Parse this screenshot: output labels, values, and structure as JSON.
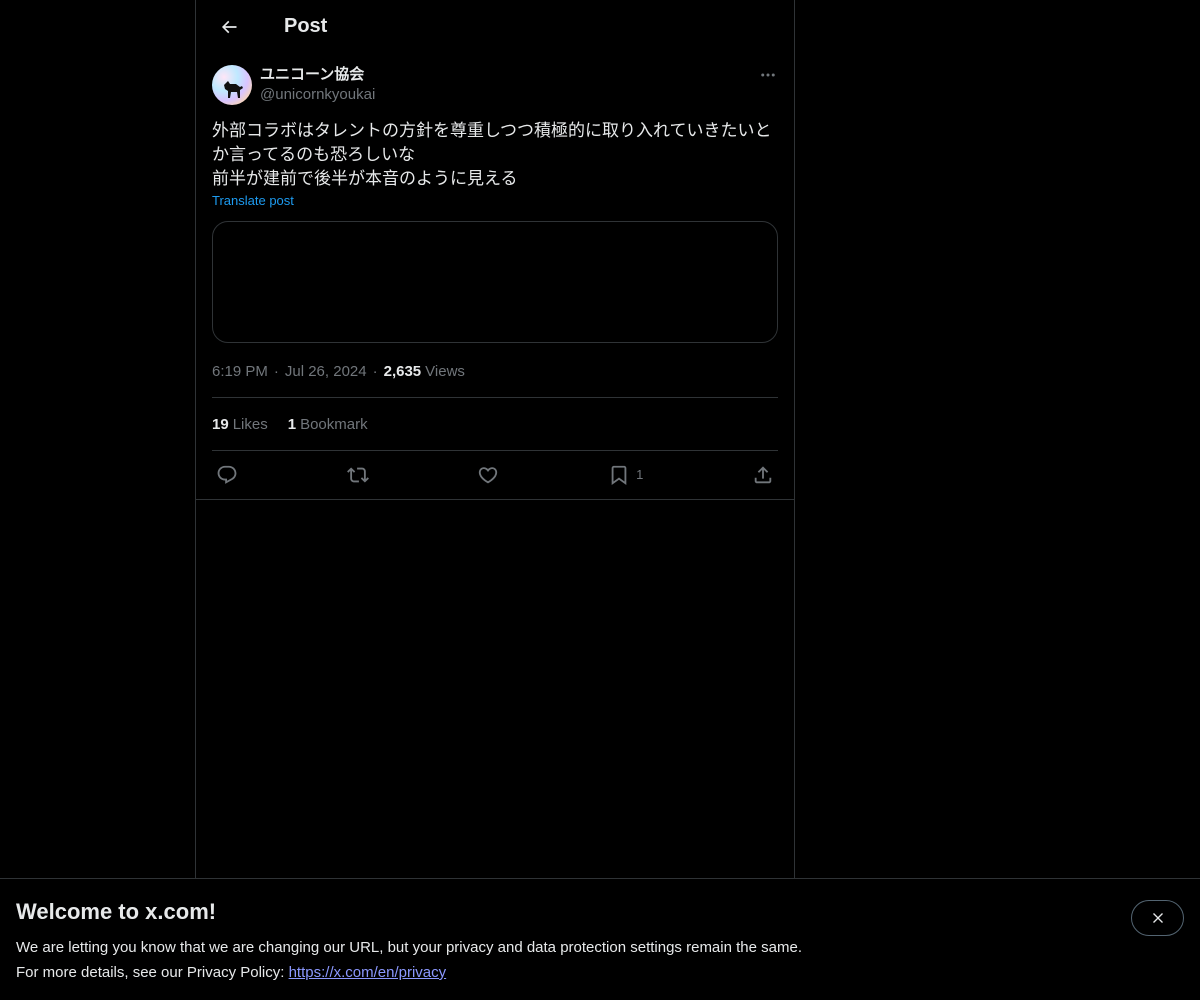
{
  "header": {
    "title": "Post"
  },
  "post": {
    "author": {
      "display_name": "ユニコーン協会",
      "handle": "@unicornkyoukai"
    },
    "text": "外部コラボはタレントの方針を尊重しつつ積極的に取り入れていきたいとか言ってるのも恐ろしいな\n前半が建前で後半が本音のように見える",
    "translate_label": "Translate post",
    "time": "6:19 PM",
    "date": "Jul 26, 2024",
    "views_count": "2,635",
    "views_label": "Views",
    "separator": "·"
  },
  "stats": {
    "likes_count": "19",
    "likes_label": "Likes",
    "bookmarks_count": "1",
    "bookmarks_label": "Bookmark"
  },
  "actions": {
    "bookmark_count": "1"
  },
  "banner": {
    "title": "Welcome to x.com!",
    "line1": "We are letting you know that we are changing our URL, but your privacy and data protection settings remain the same.",
    "line2_prefix": "For more details, see our Privacy Policy: ",
    "link": "https://x.com/en/privacy"
  },
  "colors": {
    "background": "#000000",
    "text_primary": "#e7e9ea",
    "text_secondary": "#71767b",
    "border": "#2f3336",
    "accent": "#1d9bf0",
    "link": "#8b98ff"
  }
}
